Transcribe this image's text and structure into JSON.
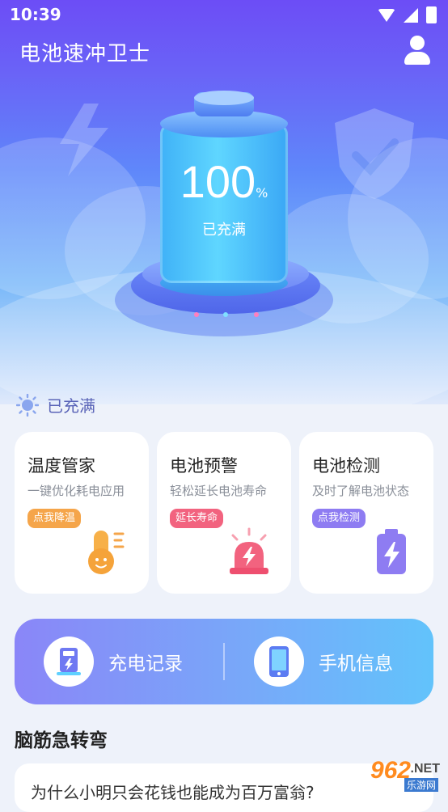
{
  "status_bar": {
    "time": "10:39"
  },
  "header": {
    "title": "电池速冲卫士",
    "user_icon": "user-icon"
  },
  "battery": {
    "percent": "100",
    "percent_sign": "%",
    "state_label": "已充满"
  },
  "status": {
    "text": "已充满",
    "icon": "sun-icon"
  },
  "cards": [
    {
      "title": "温度管家",
      "subtitle": "一键优化耗电应用",
      "button": "点我降温",
      "color": "#f5a54a",
      "icon": "thermometer-icon"
    },
    {
      "title": "电池预警",
      "subtitle": "轻松延长电池寿命",
      "button": "延长寿命",
      "color": "#f2637f",
      "icon": "alarm-icon"
    },
    {
      "title": "电池检测",
      "subtitle": "及时了解电池状态",
      "button": "点我检测",
      "color": "#8e7cf2",
      "icon": "battery-check-icon"
    }
  ],
  "banner": {
    "left_label": "充电记录",
    "left_icon": "charge-record-icon",
    "right_label": "手机信息",
    "right_icon": "phone-icon"
  },
  "riddle_section": {
    "title": "脑筋急转弯",
    "question": "为什么小明只会花钱也能成为百万富翁?"
  },
  "watermark": {
    "brand": "962",
    "suffix": ".NET",
    "sub": "乐游网"
  }
}
